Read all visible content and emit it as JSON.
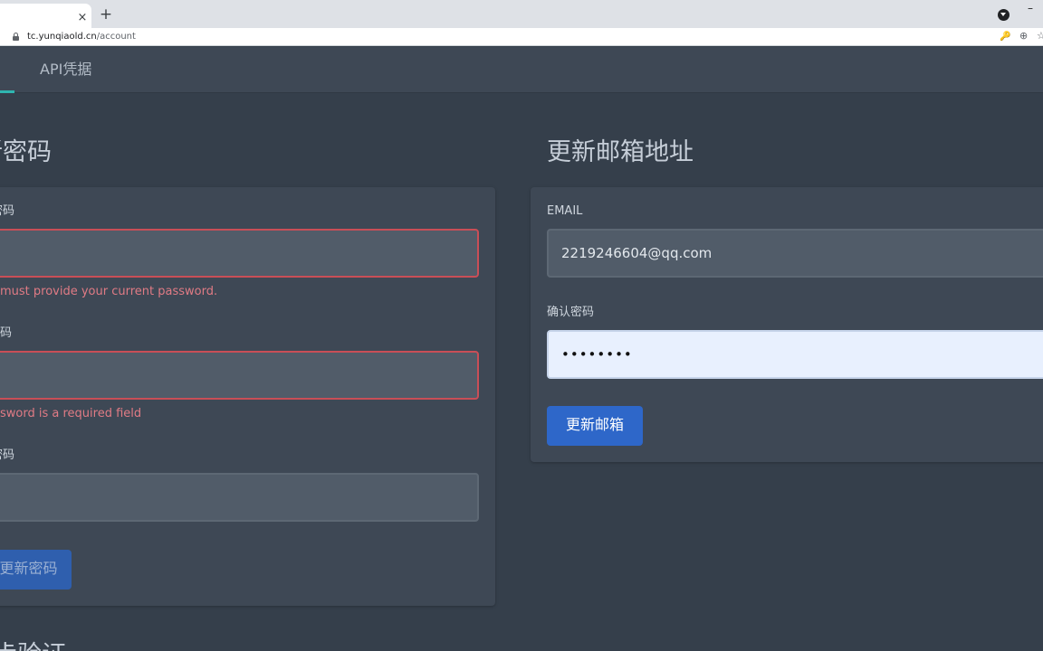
{
  "browser": {
    "tab_close_glyph": "×",
    "new_tab_glyph": "+",
    "url_host": "tc.yunqiaold.cn",
    "url_path": "/account"
  },
  "nav": {
    "api_label": "API凭据"
  },
  "password_section": {
    "title": "新密码",
    "fields": [
      {
        "label": "密码",
        "value": "",
        "error": "must provide your current password."
      },
      {
        "label": "码",
        "value": "",
        "error": "sword is a required field"
      },
      {
        "label": "密码",
        "value": ""
      }
    ],
    "submit_label": "更新密码"
  },
  "email_section": {
    "title": "更新邮箱地址",
    "email_label": "EMAIL",
    "email_value": "2219246604@qq.com",
    "confirm_label": "确认密码",
    "confirm_value": "••••••••",
    "submit_label": "更新邮箱"
  },
  "bottom_section": {
    "title": "步验证"
  },
  "colors": {
    "background": "#353f4b",
    "card": "#3e4855",
    "accent": "#2fb5b0",
    "button": "#2e67c9",
    "error": "#e07b85"
  }
}
